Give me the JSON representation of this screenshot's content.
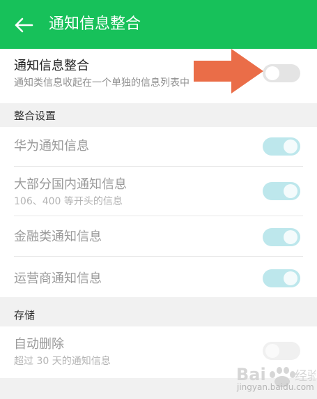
{
  "appbar": {
    "title": "通知信息整合",
    "back_icon": "arrow-left-icon"
  },
  "master": {
    "title": "通知信息整合",
    "subtitle": "通知类信息收起在一个单独的信息列表中",
    "enabled": false
  },
  "sections": {
    "merge_settings": "整合设置",
    "storage": "存储"
  },
  "merge_items": [
    {
      "title": "华为通知信息",
      "subtitle": "",
      "enabled": true
    },
    {
      "title": "大部分国内通知信息",
      "subtitle": "106、400 等开头的信息",
      "enabled": true
    },
    {
      "title": "金融类通知信息",
      "subtitle": "",
      "enabled": true
    },
    {
      "title": "运营商通知信息",
      "subtitle": "",
      "enabled": true
    }
  ],
  "storage_items": [
    {
      "title": "自动删除",
      "subtitle": "超过 30 天的通知信息",
      "enabled": false
    }
  ],
  "overlay": {
    "arrow_color": "#e8623a"
  },
  "watermark": {
    "text": "jingyan.baidu.com"
  },
  "colors": {
    "appbar": "#17c15a",
    "toggle_on_disabled": "#bde7ec",
    "toggle_off": "#e4e4e4"
  }
}
